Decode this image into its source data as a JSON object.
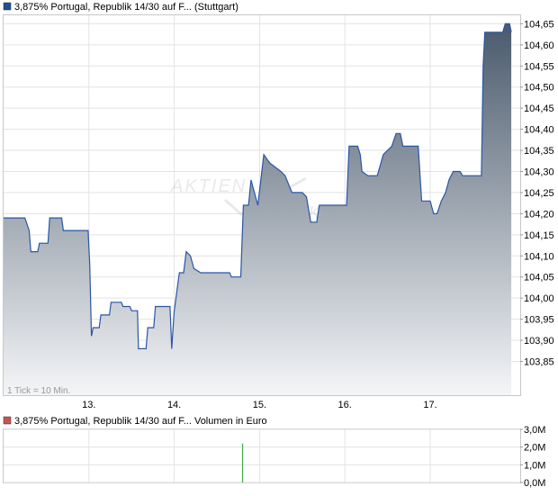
{
  "chart_data": [
    {
      "type": "area",
      "legend": "3,875% Portugal, Republik 14/30 auf F... (Stuttgart)",
      "legend_color": "#1f4e99",
      "line_color": "#2a56a6",
      "fill_top_color": "#4a5a6c",
      "fill_bottom_color": "#f4f5f7",
      "watermark": "AKTIEN",
      "watermark_tail": "CHECK",
      "footnote": "1 Tick = 10 Min.",
      "ylim": [
        103.77,
        104.67
      ],
      "y_ticks": [
        {
          "value": 103.85,
          "label": "103,85"
        },
        {
          "value": 103.9,
          "label": "103,90"
        },
        {
          "value": 103.95,
          "label": "103,95"
        },
        {
          "value": 104.0,
          "label": "104,00"
        },
        {
          "value": 104.05,
          "label": "104,05"
        },
        {
          "value": 104.1,
          "label": "104,10"
        },
        {
          "value": 104.15,
          "label": "104,15"
        },
        {
          "value": 104.2,
          "label": "104,20"
        },
        {
          "value": 104.25,
          "label": "104,25"
        },
        {
          "value": 104.3,
          "label": "104,30"
        },
        {
          "value": 104.35,
          "label": "104,35"
        },
        {
          "value": 104.4,
          "label": "104,40"
        },
        {
          "value": 104.45,
          "label": "104,45"
        },
        {
          "value": 104.5,
          "label": "104,50"
        },
        {
          "value": 104.55,
          "label": "104,55"
        },
        {
          "value": 104.6,
          "label": "104,60"
        },
        {
          "value": 104.65,
          "label": "104,65"
        }
      ],
      "x_ticks": [
        {
          "value": 1,
          "label": "13."
        },
        {
          "value": 2,
          "label": "14."
        },
        {
          "value": 3,
          "label": "15."
        },
        {
          "value": 4,
          "label": "16."
        },
        {
          "value": 5,
          "label": "17."
        }
      ],
      "xlim": [
        0,
        6
      ],
      "series": [
        {
          "values": [
            [
              0.0,
              104.19
            ],
            [
              0.25,
              104.19
            ],
            [
              0.3,
              104.16
            ],
            [
              0.32,
              104.11
            ],
            [
              0.4,
              104.11
            ],
            [
              0.42,
              104.13
            ],
            [
              0.52,
              104.13
            ],
            [
              0.54,
              104.19
            ],
            [
              0.68,
              104.19
            ],
            [
              0.7,
              104.16
            ],
            [
              0.99,
              104.16
            ],
            [
              1.01,
              104.08
            ],
            [
              1.03,
              103.91
            ],
            [
              1.05,
              103.93
            ],
            [
              1.12,
              103.93
            ],
            [
              1.14,
              103.96
            ],
            [
              1.24,
              103.96
            ],
            [
              1.26,
              103.99
            ],
            [
              1.38,
              103.99
            ],
            [
              1.4,
              103.98
            ],
            [
              1.48,
              103.98
            ],
            [
              1.5,
              103.97
            ],
            [
              1.57,
              103.97
            ],
            [
              1.58,
              103.88
            ],
            [
              1.67,
              103.88
            ],
            [
              1.69,
              103.93
            ],
            [
              1.76,
              103.93
            ],
            [
              1.78,
              103.98
            ],
            [
              1.95,
              103.98
            ],
            [
              1.97,
              103.88
            ],
            [
              2.0,
              103.97
            ],
            [
              2.06,
              104.06
            ],
            [
              2.11,
              104.06
            ],
            [
              2.14,
              104.11
            ],
            [
              2.19,
              104.1
            ],
            [
              2.23,
              104.07
            ],
            [
              2.31,
              104.06
            ],
            [
              2.65,
              104.06
            ],
            [
              2.67,
              104.05
            ],
            [
              2.78,
              104.05
            ],
            [
              2.81,
              104.22
            ],
            [
              2.87,
              104.22
            ],
            [
              2.9,
              104.28
            ],
            [
              2.98,
              104.22
            ],
            [
              3.05,
              104.34
            ],
            [
              3.12,
              104.32
            ],
            [
              3.25,
              104.3
            ],
            [
              3.3,
              104.29
            ],
            [
              3.38,
              104.25
            ],
            [
              3.5,
              104.25
            ],
            [
              3.55,
              104.24
            ],
            [
              3.6,
              104.18
            ],
            [
              3.67,
              104.18
            ],
            [
              3.7,
              104.22
            ],
            [
              4.02,
              104.22
            ],
            [
              4.05,
              104.36
            ],
            [
              4.15,
              104.36
            ],
            [
              4.18,
              104.34
            ],
            [
              4.2,
              104.3
            ],
            [
              4.27,
              104.29
            ],
            [
              4.38,
              104.29
            ],
            [
              4.45,
              104.34
            ],
            [
              4.55,
              104.36
            ],
            [
              4.6,
              104.39
            ],
            [
              4.65,
              104.39
            ],
            [
              4.68,
              104.36
            ],
            [
              4.86,
              104.36
            ],
            [
              4.9,
              104.23
            ],
            [
              5.0,
              104.23
            ],
            [
              5.04,
              104.2
            ],
            [
              5.08,
              104.2
            ],
            [
              5.13,
              104.23
            ],
            [
              5.18,
              104.25
            ],
            [
              5.22,
              104.28
            ],
            [
              5.27,
              104.3
            ],
            [
              5.35,
              104.3
            ],
            [
              5.38,
              104.29
            ],
            [
              5.6,
              104.29
            ],
            [
              5.62,
              104.55
            ],
            [
              5.64,
              104.63
            ],
            [
              5.85,
              104.63
            ],
            [
              5.88,
              104.65
            ],
            [
              5.93,
              104.65
            ],
            [
              5.95,
              104.63
            ]
          ]
        }
      ]
    },
    {
      "type": "bar",
      "legend": "3,875% Portugal, Republik 14/30 auf F... Volumen in Euro",
      "legend_color": "#c85450",
      "bar_color": "#3fae3f",
      "ylim": [
        0,
        3.0
      ],
      "y_ticks": [
        {
          "value": 0,
          "label": "0,0M"
        },
        {
          "value": 1,
          "label": "1,0M"
        },
        {
          "value": 2,
          "label": "2,0M"
        },
        {
          "value": 3,
          "label": "3,0M"
        }
      ],
      "xlim": [
        0,
        6
      ],
      "series": [
        {
          "values": [
            [
              2.8,
              2.2
            ]
          ]
        }
      ]
    }
  ]
}
